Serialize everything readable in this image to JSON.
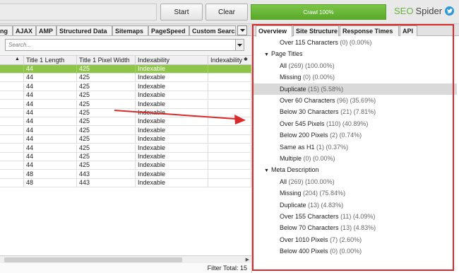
{
  "toolbar": {
    "start_label": "Start",
    "clear_label": "Clear",
    "crawl_label": "Crawl 100%",
    "crawl_progress": 1.0,
    "brand_seo": "SEO",
    "brand_spider": "Spider"
  },
  "left_tabs": [
    "ng",
    "AJAX",
    "AMP",
    "Structured Data",
    "Sitemaps",
    "PageSpeed",
    "Custom Searc"
  ],
  "search": {
    "placeholder": "Search..."
  },
  "grid": {
    "headers": [
      "",
      "Title 1 Length",
      "Title 1 Pixel Width",
      "Indexability",
      "Indexability"
    ],
    "rows": [
      [
        "44",
        "425",
        "Indexable"
      ],
      [
        "44",
        "425",
        "Indexable"
      ],
      [
        "44",
        "425",
        "Indexable"
      ],
      [
        "44",
        "425",
        "Indexable"
      ],
      [
        "44",
        "425",
        "Indexable"
      ],
      [
        "44",
        "425",
        "Indexable"
      ],
      [
        "44",
        "425",
        "Indexable"
      ],
      [
        "44",
        "425",
        "Indexable"
      ],
      [
        "44",
        "425",
        "Indexable"
      ],
      [
        "44",
        "425",
        "Indexable"
      ],
      [
        "44",
        "425",
        "Indexable"
      ],
      [
        "44",
        "425",
        "Indexable"
      ],
      [
        "48",
        "443",
        "Indexable"
      ],
      [
        "48",
        "443",
        "Indexable"
      ]
    ],
    "selected_row": 0,
    "filter_total_label": "Filter Total:",
    "filter_total_value": "15"
  },
  "right_tabs": [
    "Overview",
    "Site Structure",
    "Response Times",
    "API"
  ],
  "tree": [
    {
      "type": "leaf",
      "label": "Over 115 Characters",
      "count": "(0) (0.00%)"
    },
    {
      "type": "group",
      "label": "Page Titles"
    },
    {
      "type": "leaf",
      "label": "All",
      "count": "(269) (100.00%)"
    },
    {
      "type": "leaf",
      "label": "Missing",
      "count": "(0) (0.00%)"
    },
    {
      "type": "leaf",
      "label": "Duplicate",
      "count": "(15) (5.58%)",
      "highlight": true
    },
    {
      "type": "leaf",
      "label": "Over 60 Characters",
      "count": "(96) (35.69%)"
    },
    {
      "type": "leaf",
      "label": "Below 30 Characters",
      "count": "(21) (7.81%)"
    },
    {
      "type": "leaf",
      "label": "Over 545 Pixels",
      "count": "(110) (40.89%)"
    },
    {
      "type": "leaf",
      "label": "Below 200 Pixels",
      "count": "(2) (0.74%)"
    },
    {
      "type": "leaf",
      "label": "Same as H1",
      "count": "(1) (0.37%)"
    },
    {
      "type": "leaf",
      "label": "Multiple",
      "count": "(0) (0.00%)"
    },
    {
      "type": "group",
      "label": "Meta Description"
    },
    {
      "type": "leaf",
      "label": "All",
      "count": "(269) (100.00%)"
    },
    {
      "type": "leaf",
      "label": "Missing",
      "count": "(204) (75.84%)"
    },
    {
      "type": "leaf",
      "label": "Duplicate",
      "count": "(13) (4.83%)"
    },
    {
      "type": "leaf",
      "label": "Over 155 Characters",
      "count": "(11) (4.09%)"
    },
    {
      "type": "leaf",
      "label": "Below 70 Characters",
      "count": "(13) (4.83%)"
    },
    {
      "type": "leaf",
      "label": "Over 1010 Pixels",
      "count": "(7) (2.60%)"
    },
    {
      "type": "leaf",
      "label": "Below 400 Pixels",
      "count": "(0) (0.00%)"
    }
  ],
  "colors": {
    "brand_green": "#6cb33e",
    "selected_row": "#8ec447",
    "annotation_red": "#d92b2b",
    "twitter_blue": "#2e9ad8"
  }
}
